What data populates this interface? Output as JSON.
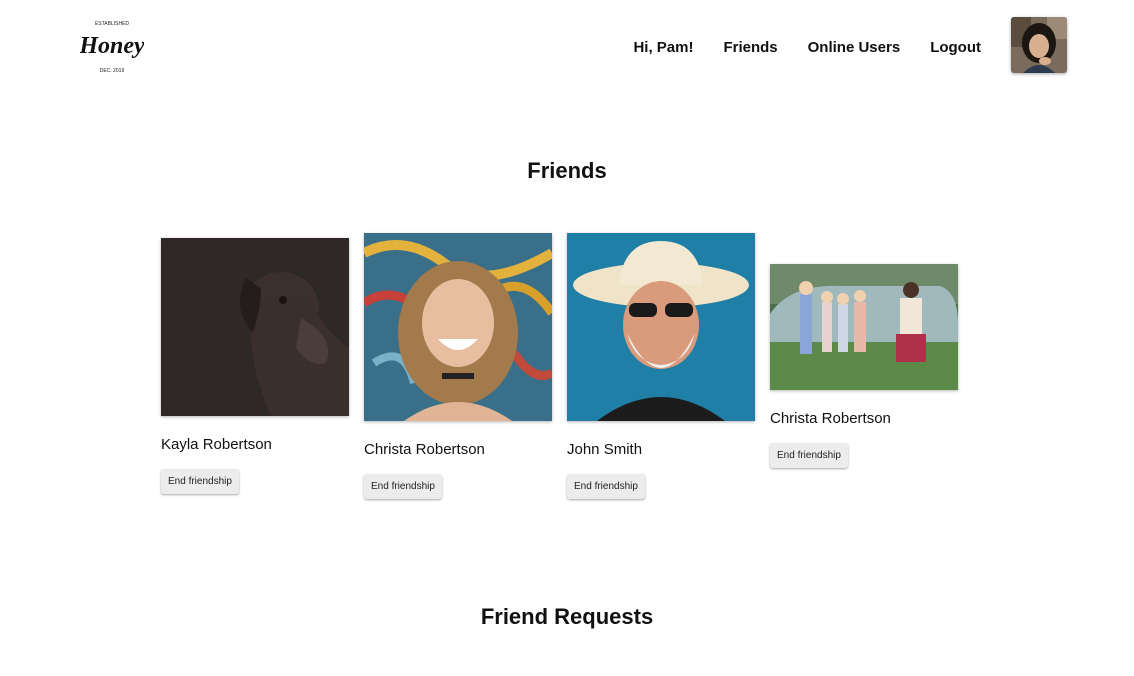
{
  "brand": {
    "logo_top_text": "ESTABLISHED",
    "logo_word": "Honey",
    "logo_bottom_text": "DEC. 2019"
  },
  "nav": {
    "greeting": "Hi, Pam!",
    "friends": "Friends",
    "online_users": "Online Users",
    "logout": "Logout"
  },
  "main": {
    "friends_heading": "Friends",
    "requests_heading": "Friend Requests",
    "friends": [
      {
        "name": "Kayla Robertson",
        "button": "End friendship",
        "photo": "dog-portrait-photo"
      },
      {
        "name": "Christa Robertson",
        "button": "End friendship",
        "photo": "smiling-woman-photo"
      },
      {
        "name": "John Smith",
        "button": "End friendship",
        "photo": "man-in-cowboy-hat-photo"
      },
      {
        "name": "Christa Robertson",
        "button": "End friendship",
        "photo": "vintage-family-photo"
      }
    ]
  },
  "colors": {
    "background": "#ffffff",
    "text": "#111111",
    "button_bg": "#ececec"
  }
}
